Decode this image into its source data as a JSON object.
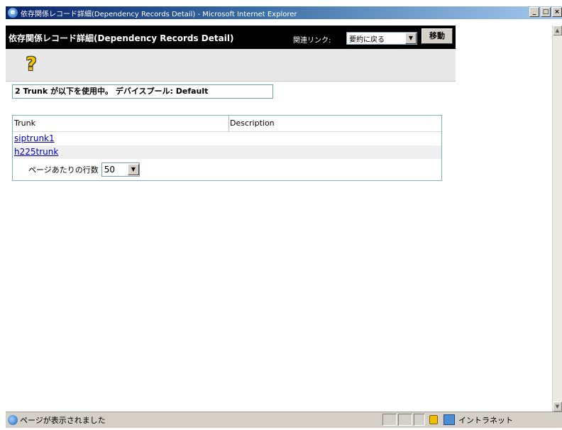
{
  "window": {
    "title": "依存関係レコード詳細(Dependency Records Detail) - Microsoft Internet Explorer",
    "minimize": "_",
    "maximize": "□",
    "close": "×"
  },
  "header": {
    "title": "依存関係レコード詳細(Dependency Records Detail)",
    "related_links_label": "関連リンク:",
    "related_links_value": "要約に戻る",
    "go_button": "移動"
  },
  "toolbar": {
    "help_icon": "help-icon",
    "help_glyph": "?"
  },
  "status_message": "2 Trunk が以下を使用中。 デバイスプール: Default",
  "table": {
    "columns": [
      "Trunk",
      "Description"
    ],
    "rows": [
      {
        "trunk": "siptrunk1",
        "description": ""
      },
      {
        "trunk": "h225trunk",
        "description": ""
      }
    ],
    "rows_per_page_label": "ページあたりの行数",
    "rows_per_page_value": "50"
  },
  "statusbar": {
    "text": "ページが表示されました",
    "zone": "イントラネット"
  }
}
